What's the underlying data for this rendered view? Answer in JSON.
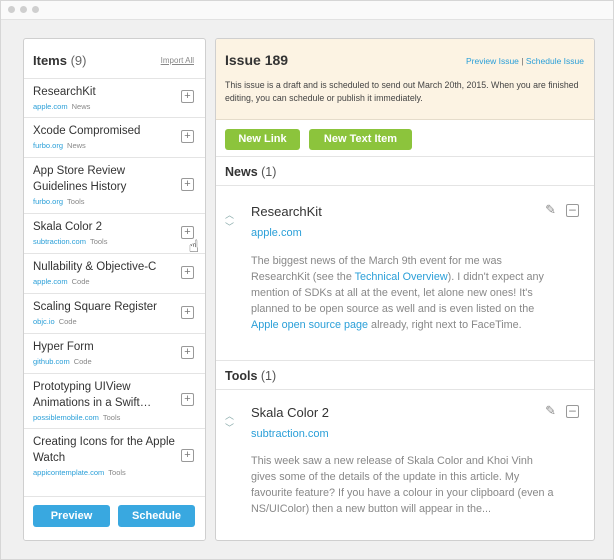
{
  "left_panel": {
    "title": "Items",
    "count": "(9)",
    "import_label": "Import All",
    "items": [
      {
        "title": "ResearchKit",
        "source": "apple.com",
        "category": "News"
      },
      {
        "title": "Xcode Compromised",
        "source": "furbo.org",
        "category": "News"
      },
      {
        "title": "App Store Review Guidelines History",
        "source": "furbo.org",
        "category": "Tools"
      },
      {
        "title": "Skala Color 2",
        "source": "subtraction.com",
        "category": "Tools"
      },
      {
        "title": "Nullability & Objective-C",
        "source": "apple.com",
        "category": "Code"
      },
      {
        "title": "Scaling Square Register",
        "source": "objc.io",
        "category": "Code"
      },
      {
        "title": "Hyper Form",
        "source": "github.com",
        "category": "Code"
      },
      {
        "title": "Prototyping UIView Animations in a Swift…",
        "source": "possiblemobile.com",
        "category": "Tools"
      },
      {
        "title": "Creating Icons for the Apple Watch",
        "source": "appicontemplate.com",
        "category": "Tools"
      }
    ],
    "preview_label": "Preview",
    "schedule_label": "Schedule"
  },
  "right_panel": {
    "title": "Issue 189",
    "preview_issue_label": "Preview Issue",
    "separator": "|",
    "schedule_issue_label": "Schedule Issue",
    "notice": "This issue is a draft and is scheduled to send out March 20th, 2015.  When you are finished editing, you can schedule or publish it immediately.",
    "new_link_label": "New Link",
    "new_text_item_label": "New Text Item",
    "sections": [
      {
        "title": "News",
        "count": "(1)",
        "entry": {
          "title": "ResearchKit",
          "source": "apple.com",
          "body_1": "The biggest news of the March 9th event for me was ResearchKit (see the ",
          "link_1": "Technical Overview",
          "body_2": "). I didn't expect any mention of SDKs at all at the event, let alone new ones! It's planned to be open source as well and is even listed on the ",
          "link_2": "Apple open source page",
          "body_3": " already, right next to FaceTime."
        }
      },
      {
        "title": "Tools",
        "count": "(1)",
        "entry": {
          "title": "Skala Color 2",
          "source": "subtraction.com",
          "body": "This week saw a new release of Skala Color and Khoi Vinh gives some of the details of the update in this article. My favourite feature? If you have a colour in your clipboard (even a NS/UIColor) then a new button will appear in the..."
        }
      }
    ]
  },
  "icons": {
    "add": "plus-square-icon",
    "remove": "minus-square-icon",
    "edit": "pencil-icon",
    "up": "chevron-up-icon",
    "down": "chevron-down-icon",
    "cursor": "hand-pointer-icon"
  },
  "colors": {
    "accent_blue": "#39a8e0",
    "accent_green": "#8cc43c",
    "link": "#2a9fd8",
    "notice_bg": "#fcf3e3"
  }
}
